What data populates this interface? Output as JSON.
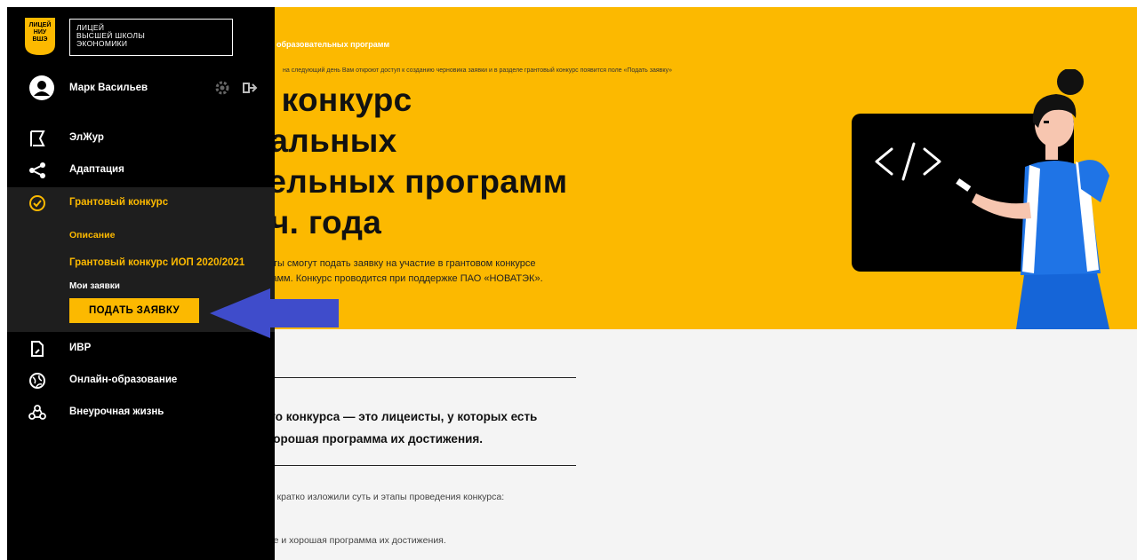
{
  "hero": {
    "breadcrumb": "образовательных программ",
    "note": "на следующий день Вам откроют доступ к созданию черновика заявки и в разделе грантовый конкурс появится поле «Подать заявку»",
    "title_lines": [
      "й конкурс",
      "уальных",
      "тельных программ",
      "уч. года"
    ],
    "desc_lines": [
      "цеисты смогут подать заявку на участие в грантовом конкурсе",
      "рограмм. Конкурс проводится при поддержке ПАО «НОВАТЭК»."
    ]
  },
  "content": {
    "lead_lines": [
      "вого конкурса — это лицеисты, у которых есть",
      "и хорошая программа их достижения."
    ],
    "para1": ", мы кратко изложили суть и этапы проведения конкурса:",
    "para2": "ущее и хорошая программа их достижения."
  },
  "sidebar": {
    "logo_badge_lines": [
      "ЛИЦЕЙ",
      "НИУ",
      "ВШЭ"
    ],
    "logo_text_lines": [
      "ЛИЦЕЙ",
      "ВЫСШЕЙ ШКОЛЫ",
      "ЭКОНОМИКИ"
    ],
    "user_name": "Марк Васильев",
    "items": [
      {
        "label": "ЭлЖур",
        "icon": "flag-icon"
      },
      {
        "label": "Адаптация",
        "icon": "share-icon"
      },
      {
        "label": "Грантовый конкурс",
        "icon": "check-circle-icon"
      },
      {
        "label": "ИВР",
        "icon": "document-edit-icon"
      },
      {
        "label": "Онлайн-образование",
        "icon": "globe-icon"
      },
      {
        "label": "Внеурочная жизнь",
        "icon": "people-icon"
      }
    ],
    "submenu": {
      "description": "Описание",
      "contest": "Грантовый конкурс ИОП 2020/2021",
      "my_applications": "Мои заявки",
      "apply_button": "ПОДАТЬ ЗАЯВКУ"
    }
  },
  "colors": {
    "accent": "#fcb900",
    "sidebar_bg": "#000000",
    "submenu_bg": "#1e1e1e",
    "arrow": "#3f4ccb"
  }
}
